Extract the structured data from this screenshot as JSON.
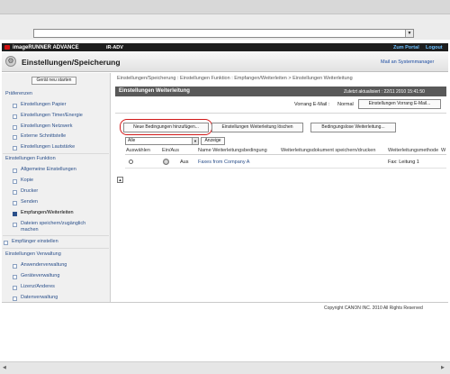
{
  "topbar": {
    "logo": "imageRUNNER ADVANCE",
    "device": "iR-ADV",
    "portal_link": "Zum Portal",
    "logout_link": "Logout"
  },
  "header": {
    "title": "Einstellungen/Speicherung",
    "mail_link": "Mail an Systemmanager"
  },
  "sidebar": {
    "restart_button": "Gerät neu starten",
    "sections": [
      {
        "heading": "Präferenzen",
        "items": [
          "Einstellungen Papier",
          "Einstellungen Timer/Energie",
          "Einstellungen Netzwerk",
          "Externe Schnittstelle",
          "Einstellungen Lautstärke"
        ]
      },
      {
        "heading": "Einstellungen Funktion",
        "items": [
          "Allgemeine Einstellungen",
          "Kopie",
          "Drucker",
          "Senden",
          "Empfangen/Weiterleiten",
          "Dateien speichern/zugänglich machen"
        ]
      },
      {
        "heading": "Empfänger einstellen",
        "items": []
      },
      {
        "heading": "Einstellungen Verwaltung",
        "items": [
          "Anwenderverwaltung",
          "Geräteverwaltung",
          "Lizenz/Anderes",
          "Datenverwaltung"
        ]
      }
    ]
  },
  "main": {
    "breadcrumb": "Einstellungen/Speicherung : Einstellungen Funktion : Empfangen/Weiterleiten > Einstellungen Weiterleitung",
    "panel_title": "Einstellungen Weiterleitung",
    "last_updated": "Zuletzt aktualisiert : 22/11 2010 15:41:50",
    "vorrang_label": "Vorrang E-Mail :",
    "vorrang_value": "Normal",
    "vorrang_button": "Einstellungen Vorrang E-Mail...",
    "buttons": {
      "add_condition": "Neue Bedingungen hinzufügen...",
      "delete": "Einstellungen Weiterleitung löschen",
      "unconditional": "Bedingungslose Weiterleitung..."
    },
    "filter": {
      "selected": "Alle",
      "button": "Anzeige"
    },
    "table": {
      "columns": [
        "Auswählen",
        "Ein/Aus",
        "Name Weiterleitungsbedingung",
        "Weiterleitungsdokument speichern/drucken",
        "Weiterleitungsmethode",
        "W"
      ],
      "rows": [
        {
          "onoff": "Aus",
          "name": "Faxes from Company A",
          "method": "Fax: Leitung 1"
        }
      ]
    }
  },
  "footer": {
    "copyright": "Copyright CANON INC. 2010 All Rights Reserved"
  }
}
